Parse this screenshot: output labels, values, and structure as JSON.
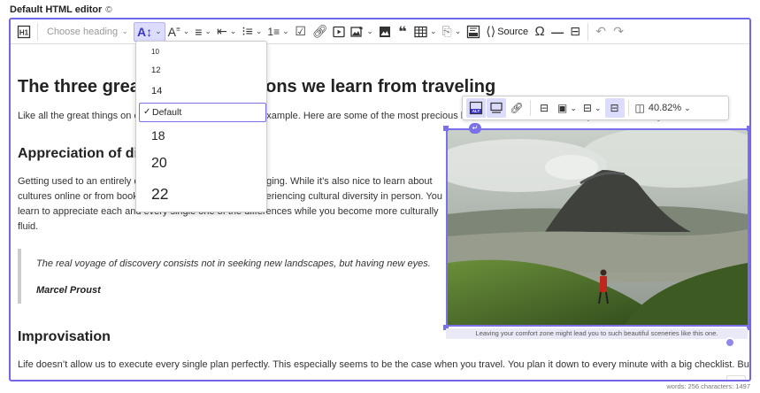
{
  "page": {
    "label": "Default HTML editor",
    "label_icon": "copyright-icon"
  },
  "toolbar": {
    "heading_placeholder": "Choose heading",
    "source_label": "Source",
    "icons": [
      "show-blocks-icon",
      "heading-dropdown",
      "font-size-icon",
      "text-style-icon",
      "align-icon",
      "indent-icon",
      "bulleted-list-icon",
      "numbered-list-icon",
      "todo-list-icon",
      "link-icon",
      "media-icon",
      "insert-image-icon",
      "image-icon",
      "blockquote-icon",
      "table-icon",
      "template-icon",
      "html-embed-icon",
      "source-icon",
      "special-characters-icon",
      "horizontal-line-icon",
      "page-break-icon",
      "undo-icon",
      "redo-icon"
    ]
  },
  "font_size_dropdown": {
    "options": [
      "10",
      "12",
      "14",
      "Default",
      "18",
      "20",
      "22"
    ],
    "selected": "Default"
  },
  "content": {
    "title": "The three great essential lessons we learn from traveling",
    "intro": "Like all the great things on earth traveling teaches us by example. Here are some of the most precious lessons I’ve learned over the years of traveling.",
    "h2_1": "Appreciation of diversity",
    "para1": [
      "Getting used to an entirely different culture can be challenging. While it’s also nice to learn about",
      "cultures online or from books, nothing comes close to experiencing cultural diversity in person. You",
      "learn to appreciate each and every single one of the differences while you become more culturally",
      "fluid."
    ],
    "quote_text": "The real voyage of discovery consists not in seeking new landscapes, but having new eyes.",
    "quote_author": "Marcel Proust",
    "h2_2": "Improvisation",
    "para2": "Life doesn’t allow us to execute every single plan perfectly. This especially seems to be the case when you travel. You plan it down to every minute with a big checklist. But",
    "image_caption": "Leaving your comfort zone might lead you to such beautiful sceneries like this one."
  },
  "image_toolbar": {
    "zoom": "40.82%"
  },
  "footer": {
    "stats": "words: 256  characters: 1497"
  },
  "colors": {
    "accent": "#6f66e8",
    "selected_bg": "#dcdcfd"
  }
}
